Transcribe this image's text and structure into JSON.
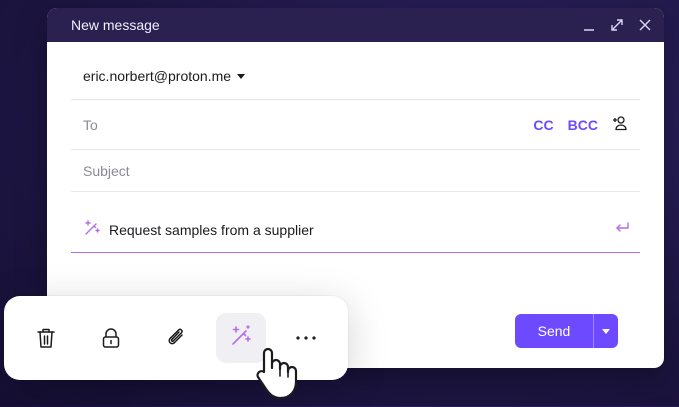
{
  "window": {
    "title": "New message",
    "controls": [
      "minimize-icon",
      "expand-icon",
      "close-icon"
    ]
  },
  "composer": {
    "from": "eric.norbert@proton.me",
    "to_placeholder": "To",
    "cc_label": "CC",
    "bcc_label": "BCC",
    "subject_placeholder": "Subject",
    "assistant_prompt": "Request samples from a supplier",
    "send_label": "Send"
  },
  "toolbar": {
    "tools": [
      "trash-icon",
      "lock-icon",
      "paperclip-icon",
      "magic-wand-icon",
      "more-icon"
    ],
    "active_tool": "magic-wand-icon"
  },
  "colors": {
    "accent": "#6d4aff",
    "assistant": "#b46de8",
    "titlebar": "#2a2150"
  }
}
